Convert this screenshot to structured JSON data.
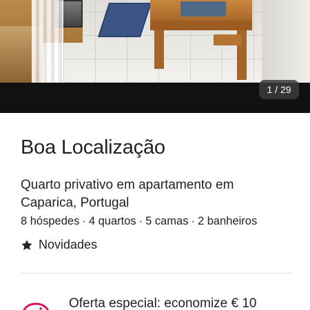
{
  "gallery": {
    "counter": "1 / 29",
    "photo_icon": "kitchen-photo"
  },
  "listing": {
    "title": "Boa Localização",
    "room_type": "Quarto privativo em apartamento em Caparica, Portugal",
    "details": [
      "8 hóspedes",
      "4 quartos",
      "5 camas",
      "2 banheiros"
    ],
    "detail_separator": "·",
    "rating_icon": "star-icon",
    "rating_label": "Novidades"
  },
  "offer": {
    "icon": "piggy-bank-icon",
    "text": "Oferta especial: economize € 10",
    "icon_color": "#E0125E"
  }
}
